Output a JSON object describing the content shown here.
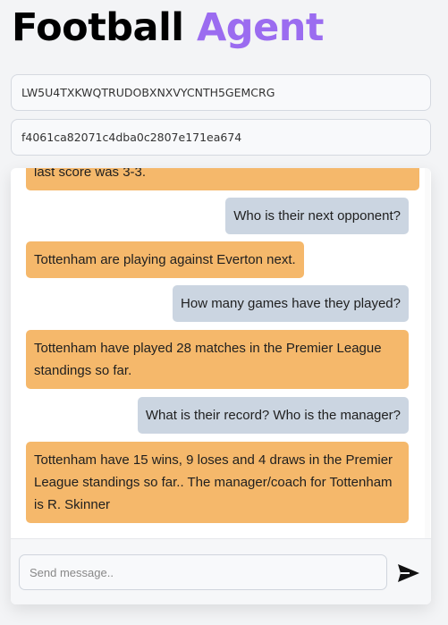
{
  "header": {
    "title_part1": "Football",
    "title_part2": "Agent"
  },
  "fields": {
    "api_key": "LW5U4TXKWQTRUDOBXNXVYCNTH5GEMCRG",
    "session_id": "f4061ca82071c4dba0c2807e171ea674"
  },
  "messages": [
    {
      "role": "bot",
      "text": "last score was 3-3."
    },
    {
      "role": "user",
      "text": "Who is their next opponent?"
    },
    {
      "role": "bot",
      "text": "Tottenham are playing against Everton next."
    },
    {
      "role": "user",
      "text": "How many games have they played?"
    },
    {
      "role": "bot",
      "text": "Tottenham have played 28 matches in the Premier League standings so far."
    },
    {
      "role": "user",
      "text": "What is their record? Who is the manager?"
    },
    {
      "role": "bot",
      "text": "Tottenham have 15 wins, 9 loses and 4 draws in the Premier League standings so far.. The manager/coach for Tottenham is R. Skinner"
    }
  ],
  "composer": {
    "placeholder": "Send message..",
    "value": ""
  },
  "icons": {
    "send": "send-arrow-icon"
  },
  "colors": {
    "accent": "#9b6cf0",
    "bot_bubble": "#f5b86b",
    "user_bubble": "#cbd5e1"
  }
}
